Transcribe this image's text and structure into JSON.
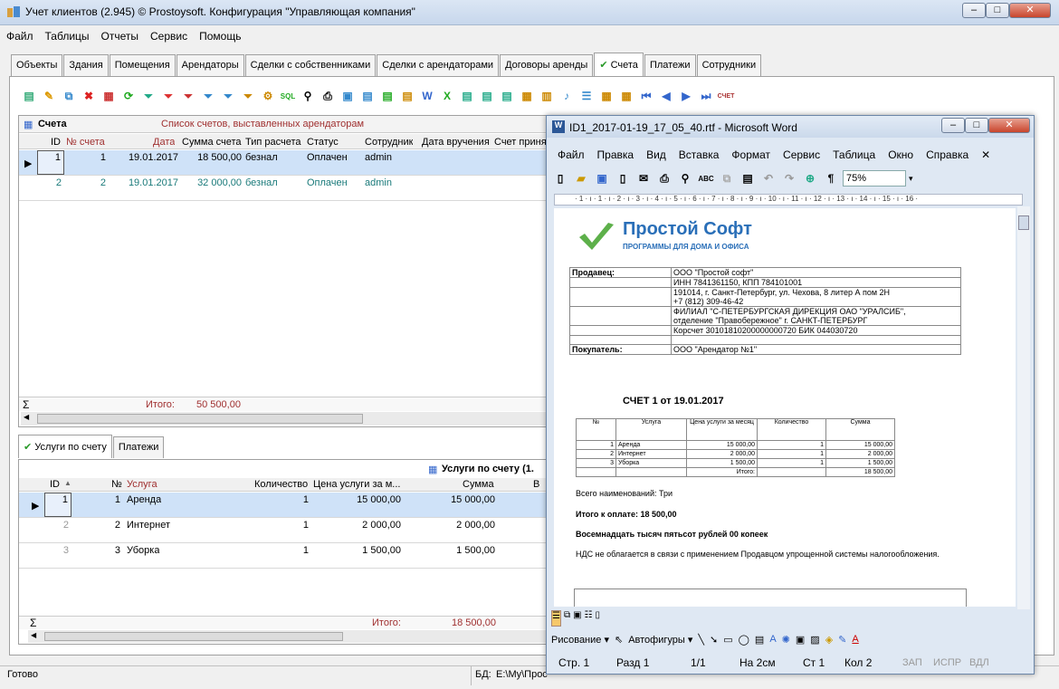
{
  "window": {
    "title": "Учет клиентов (2.945) © Prostoysoft. Конфигурация \"Управляющая компания\"",
    "min": "‒",
    "max": "□",
    "close": "✕"
  },
  "menu": [
    "Файл",
    "Таблицы",
    "Отчеты",
    "Сервис",
    "Помощь"
  ],
  "tabs": [
    "Объекты",
    "Здания",
    "Помещения",
    "Арендаторы",
    "Сделки с собственниками",
    "Сделки с арендаторами",
    "Договоры аренды",
    "Счета",
    "Платежи",
    "Сотрудники"
  ],
  "accounts": {
    "title": "Счета",
    "subtitle": "Список счетов, выставленных арендаторам",
    "columns": [
      "ID",
      "№ счета",
      "Дата",
      "Сумма счета",
      "Тип расчета",
      "Статус",
      "Сотрудник",
      "Дата вручения",
      "Счет приня"
    ],
    "rows": [
      {
        "id": "1",
        "num": "1",
        "date": "19.01.2017",
        "sum": "18 500,00",
        "type": "безнал",
        "status": "Оплачен",
        "emp": "admin"
      },
      {
        "id": "2",
        "num": "2",
        "date": "19.01.2017",
        "sum": "32 000,00",
        "type": "безнал",
        "status": "Оплачен",
        "emp": "admin"
      }
    ],
    "sigma": "Σ",
    "total_label": "Итого:",
    "total": "50 500,00"
  },
  "subtabs": [
    "Услуги по счету",
    "Платежи"
  ],
  "services": {
    "title": "Услуги по счету (1.",
    "columns": [
      "ID",
      "№",
      "Услуга",
      "Количество",
      "Цена услуги за м...",
      "Сумма",
      "В"
    ],
    "rows": [
      {
        "id": "1",
        "num": "1",
        "name": "Аренда",
        "qty": "1",
        "price": "15 000,00",
        "sum": "15 000,00"
      },
      {
        "id": "2",
        "num": "2",
        "name": "Интернет",
        "qty": "1",
        "price": "2 000,00",
        "sum": "2 000,00"
      },
      {
        "id": "3",
        "num": "3",
        "name": "Уборка",
        "qty": "1",
        "price": "1 500,00",
        "sum": "1 500,00"
      }
    ],
    "sigma": "Σ",
    "total_label": "Итого:",
    "total": "18 500,00"
  },
  "status": {
    "ready": "Готово",
    "db_label": "БД:",
    "db_path": "E:\\My\\Прос"
  },
  "word": {
    "title": "ID1_2017-01-19_17_05_40.rtf - Microsoft Word",
    "menu": [
      "Файл",
      "Правка",
      "Вид",
      "Вставка",
      "Формат",
      "Сервис",
      "Таблица",
      "Окно",
      "Справка"
    ],
    "zoom": "75%",
    "para": "¶",
    "ruler": "· 1 · ı · 1 · ı · 2 · ı · 3 · ı · 4 · ı · 5 · ı · 6 · ı · 7 · ı · 8 · ı · 9 · ı · 10 · ı · 11 · ı · 12 · ı · 13 · ı · 14 · ı · 15 · ı · 16 ·",
    "logo_title": "Простой Софт",
    "logo_sub": "ПРОГРАММЫ ДЛЯ ДОМА И ОФИСА",
    "seller_label": "Продавец:",
    "seller": [
      "ООО \"Простой софт\"",
      "ИНН 7841361150, КПП 784101001",
      "191014, г. Санкт-Петербург, ул. Чехова, 8 литер А пом 2Н\n+7 (812) 309-46-42",
      "ФИЛИАЛ \"С-ПЕТЕРБУРГСКАЯ ДИРЕКЦИЯ ОАО \"УРАЛСИБ\",\nотделение \"Правобережное\" г. САНКТ-ПЕТЕРБУРГ",
      "Корсчет 30101810200000000720 БИК 044030720"
    ],
    "buyer_label": "Покупатель:",
    "buyer": "ООО \"Арендатор №1\"",
    "invoice_title": "СЧЕТ 1 от 19.01.2017",
    "inv_cols": [
      "№",
      "Услуга",
      "Цена услуги за месяц",
      "Количество",
      "Сумма"
    ],
    "inv_rows": [
      [
        "1",
        "Аренда",
        "15 000,00",
        "1",
        "15 000,00"
      ],
      [
        "2",
        "Интернет",
        "2 000,00",
        "1",
        "2 000,00"
      ],
      [
        "3",
        "Уборка",
        "1 500,00",
        "1",
        "1 500,00"
      ]
    ],
    "inv_total_label": "Итого:",
    "inv_total": "18 500,00",
    "line1": "Всего наименований: Три",
    "line2": "Итого к оплате: 18 500,00",
    "line3": "Восемнадцать тысяч пятьсот рублей 00 копеек",
    "line4": "НДС не облагается в связи с применением Продавцом упрощенной системы налогообложения.",
    "draw": "Рисование ▾",
    "autoshapes": "Автофигуры ▾",
    "status": [
      "Стр. 1",
      "Разд 1",
      "1/1",
      "На 2см",
      "Ст 1",
      "Кол 2",
      "ЗАП",
      "ИСПР",
      "ВДЛ"
    ]
  }
}
